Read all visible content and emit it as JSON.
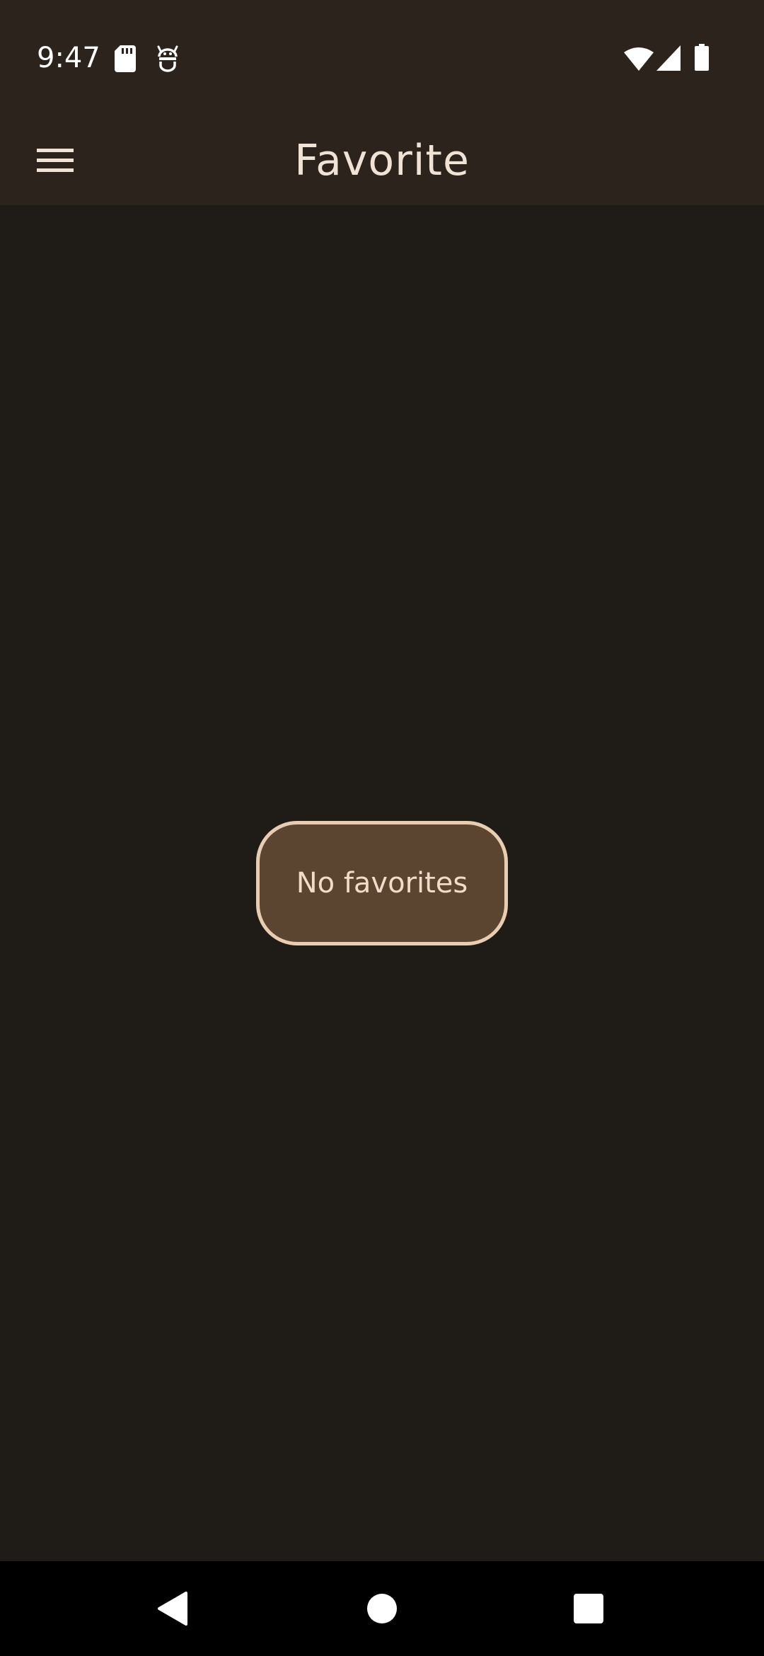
{
  "status_bar": {
    "time": "9:47",
    "icons": [
      "sd-card-icon",
      "android-debug-icon",
      "wifi-icon",
      "cell-signal-icon",
      "battery-icon"
    ]
  },
  "app_bar": {
    "title": "Favorite",
    "menu_icon": "hamburger-menu-icon"
  },
  "main": {
    "empty_state_label": "No favorites"
  },
  "nav_bar": {
    "buttons": [
      "back-icon",
      "home-icon",
      "recents-icon"
    ]
  },
  "colors": {
    "app_bar_bg": "#2c231c",
    "page_bg": "#1f1c18",
    "badge_bg": "#5b4430",
    "badge_border": "#e9cdb0",
    "title_text": "#f0e2d5"
  }
}
